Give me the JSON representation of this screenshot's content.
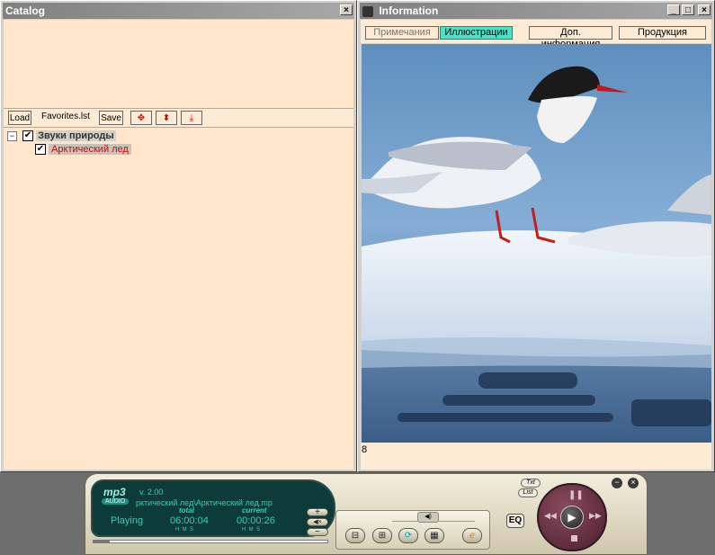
{
  "catalog": {
    "title": "Catalog",
    "close_glyph": "×",
    "toolbar": {
      "load": "Load",
      "file": "Favorites.lst",
      "save": "Save"
    },
    "tree": [
      {
        "label": "Звуки природы",
        "expander": "−",
        "checked": "✔"
      },
      {
        "label": "Арктический лед",
        "checked": "✔",
        "selected": true
      }
    ]
  },
  "information": {
    "title": "Information",
    "tabs": [
      {
        "label": "Примечания",
        "active": false
      },
      {
        "label": "Иллюстрации",
        "active": true
      },
      {
        "label": "Доп. информация",
        "active": false
      },
      {
        "label": "Продукция",
        "active": false
      }
    ],
    "image_index": "8",
    "image_subject": "arctic tern on ice floe"
  },
  "player": {
    "logo": "mp3",
    "logo_sub": "AUDIO",
    "version": "v. 2.00",
    "track": "рктический лед\\Арктический лед.mp",
    "status": "Playing",
    "total_label": "total",
    "current_label": "current",
    "total_time": "06:00:04",
    "current_time": "00:00:26",
    "hms": "H  M  S",
    "eq_label": "EQ",
    "txt_label": "Txt",
    "list_label": "List",
    "progress": 0.07,
    "colors": {
      "lcd_text": "#34d0b6",
      "lcd_bg": "#0c3b3a",
      "accent": "#00e5b5"
    }
  }
}
